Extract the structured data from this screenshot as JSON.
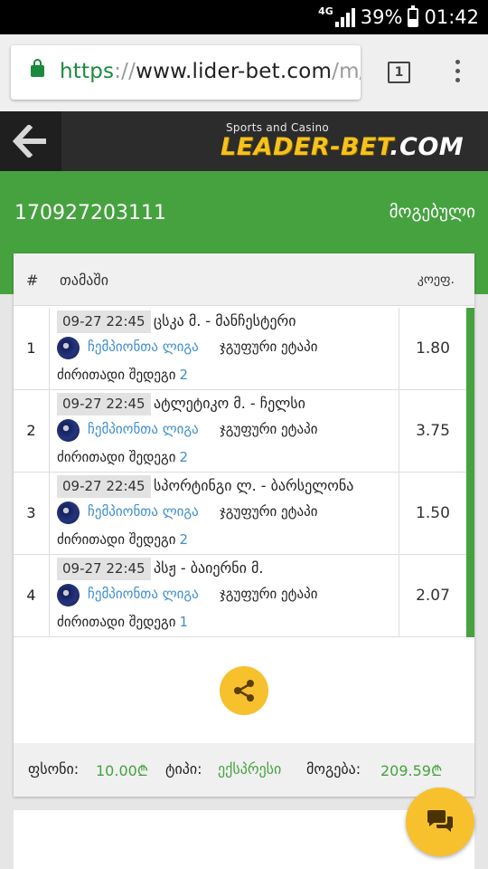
{
  "status_bar": {
    "network": "4G",
    "battery_text": "39%",
    "battery_level": 0.39,
    "time": "01:42"
  },
  "browser": {
    "url_scheme": "https",
    "url_separator": "://",
    "url_host": "www.lider-bet.com",
    "url_path": "/m/",
    "tab_count": "1"
  },
  "header": {
    "logo_tagline": "Sports and Casino",
    "logo_brand": "LEADER-BET",
    "logo_tld": ".COM"
  },
  "ticket": {
    "id": "170927203111",
    "status": "მოგებული"
  },
  "table": {
    "col_num": "#",
    "col_game": "თამაში",
    "col_odd": "კოეფ.",
    "rows": [
      {
        "num": "1",
        "datetime": "09-27 22:45",
        "match": "ცსკა მ. - მანჩესტერი",
        "league": "ჩემპიონთა ლიგა",
        "stage": "ჯგუფური ეტაპი",
        "market": "ძირითადი შედეგი",
        "pick": "2",
        "odd": "1.80"
      },
      {
        "num": "2",
        "datetime": "09-27 22:45",
        "match": "ატლეტიკო მ. - ჩელსი",
        "league": "ჩემპიონთა ლიგა",
        "stage": "ჯგუფური ეტაპი",
        "market": "ძირითადი შედეგი",
        "pick": "2",
        "odd": "3.75"
      },
      {
        "num": "3",
        "datetime": "09-27 22:45",
        "match": "სპორტინგი ლ. - ბარსელონა",
        "league": "ჩემპიონთა ლიგა",
        "stage": "ჯგუფური ეტაპი",
        "market": "ძირითადი შედეგი",
        "pick": "2",
        "odd": "1.50"
      },
      {
        "num": "4",
        "datetime": "09-27 22:45",
        "match": "პსჟ - ბაიერნი მ.",
        "league": "ჩემპიონთა ლიგა",
        "stage": "ჯგუფური ეტაპი",
        "market": "ძირითადი შედეგი",
        "pick": "1",
        "odd": "2.07"
      }
    ]
  },
  "footer": {
    "stake_label": "ფსონი:",
    "stake_value": "10.00₾",
    "type_label": "ტიპი:",
    "type_value": "ექსპრესი",
    "win_label": "მოგება:",
    "win_value": "209.59₾"
  },
  "colors": {
    "accent_green": "#46a23f",
    "accent_yellow": "#f7c02d",
    "link_blue": "#3d8ed1"
  },
  "icons": [
    "lock-icon",
    "back-arrow-icon",
    "share-icon",
    "chat-icon",
    "soccer-ball-icon",
    "more-vert-icon"
  ]
}
